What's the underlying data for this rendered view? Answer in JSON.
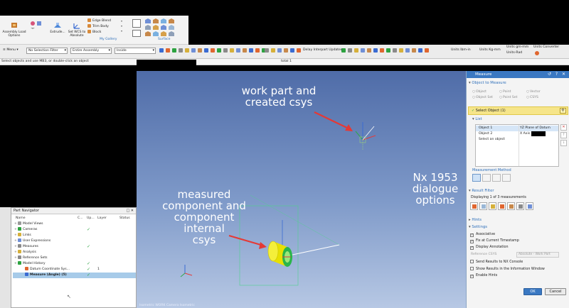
{
  "ribbon": {
    "assembly_load_options": "Assembly Load Options",
    "extrude": "Extrude...",
    "set_wcs": "Set WCS to Absolute",
    "edge_blend": "Edge Blend",
    "trim_body": "Trim Body",
    "block": "Block",
    "my_gallery": "My Gallery",
    "surface": "Surface"
  },
  "toolbar": {
    "menu": "Menu",
    "selection_filter": "No Selection Filter",
    "assembly_scope": "Entire Assembly",
    "inside": "Inside",
    "delay_interpart": "Delay Interpart Updates",
    "units_lbm_in": "Units lbm-in",
    "units_kg_mm": "Units Kg-mm",
    "units_gm_mm": "Units gm-mm",
    "units_rad": "Units-Rad",
    "units_converter": "Units Converter"
  },
  "status": {
    "prompt": "Select objects and use MB3, or double-click an object",
    "total": "total 1"
  },
  "viewport": {
    "callout_top": [
      "work part and",
      "created csys"
    ],
    "callout_left": [
      "measured",
      "component and",
      "component internal",
      "csys"
    ],
    "callout_right": [
      "Nx 1953",
      "dialogue",
      "options"
    ],
    "camera_label": "Isometric  WORK  Camera  Isometric"
  },
  "part_navigator": {
    "title": "Part Navigator",
    "columns": [
      "Name",
      "C...",
      "Up...",
      "Layer",
      "Status"
    ],
    "rows": [
      {
        "label": "Model Views",
        "depth": 0
      },
      {
        "label": "Cameras",
        "depth": 0
      },
      {
        "label": "Links",
        "depth": 0
      },
      {
        "label": "User Expressions",
        "depth": 0
      },
      {
        "label": "Measures",
        "depth": 0
      },
      {
        "label": "Analysis",
        "depth": 0
      },
      {
        "label": "Reference Sets",
        "depth": 0
      },
      {
        "label": "Model History",
        "depth": 0
      },
      {
        "label": "Datum Coordinate Sys...",
        "depth": 1,
        "layer": "1"
      },
      {
        "label": "Measure (Angle) (5)",
        "depth": 1,
        "selected": true
      }
    ]
  },
  "measure": {
    "title": "Measure",
    "object_to_measure": "Object to Measure",
    "radio_options": [
      "Object",
      "Point",
      "Vector",
      "Object Set",
      "Point Set",
      "CSYS"
    ],
    "select_object": "Select Object (1)",
    "list_label": "List",
    "list_rows": [
      {
        "name": "Object 1",
        "value": "YZ Plane of Datum"
      },
      {
        "name": "Object 2",
        "value": "X Axis in"
      },
      {
        "name": "Select an object",
        "value": ""
      }
    ],
    "measurement_method": "Measurement Method",
    "result_filter": "Result Filter",
    "displaying": "Displaying 1 of 3 measurements",
    "hints": "Hints",
    "settings": "Settings",
    "associative": "Associative",
    "fix_timestamp": "Fix at Current Timestamp",
    "display_annotation": "Display Annotation",
    "reference_csys": "Reference CSYS",
    "reference_csys_value": "Absolute - Work Part",
    "send_results": "Send Results to NX Console",
    "show_results": "Show Results in the Information Window",
    "enable_hints": "Enable Hints",
    "ok": "OK",
    "cancel": "Cancel"
  },
  "colors": {
    "dialog_title": "#3a78c2",
    "select_highlight": "#f6e58a",
    "tree_selected": "#a7cbe9",
    "cylinder": "#e8e000",
    "arrow": "#e53935"
  }
}
